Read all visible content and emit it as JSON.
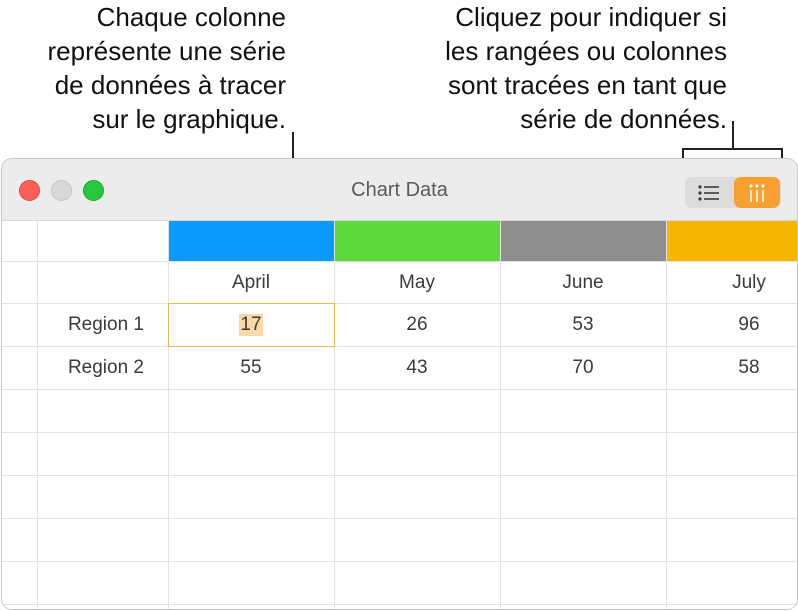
{
  "callouts": {
    "left": "Chaque colonne\nreprésente une série\nde données à tracer\nsur le graphique.",
    "right": "Cliquez pour indiquer si\nles rangées ou colonnes\nsont tracées en tant que\nsérie de données."
  },
  "window": {
    "title": "Chart Data",
    "toolbar": {
      "rows_button_icon": "list-rows-icon",
      "columns_button_icon": "columns-icon",
      "selected": "columns"
    }
  },
  "series_colors": [
    "#0a9bff",
    "#5cd83a",
    "#8e8e8e",
    "#f6b500"
  ],
  "table": {
    "columns": [
      "April",
      "May",
      "June",
      "July"
    ],
    "rows": [
      {
        "label": "Region 1",
        "values": [
          "17",
          "26",
          "53",
          "96"
        ]
      },
      {
        "label": "Region 2",
        "values": [
          "55",
          "43",
          "70",
          "58"
        ]
      }
    ],
    "selected_cell": "Region 1 / April"
  }
}
